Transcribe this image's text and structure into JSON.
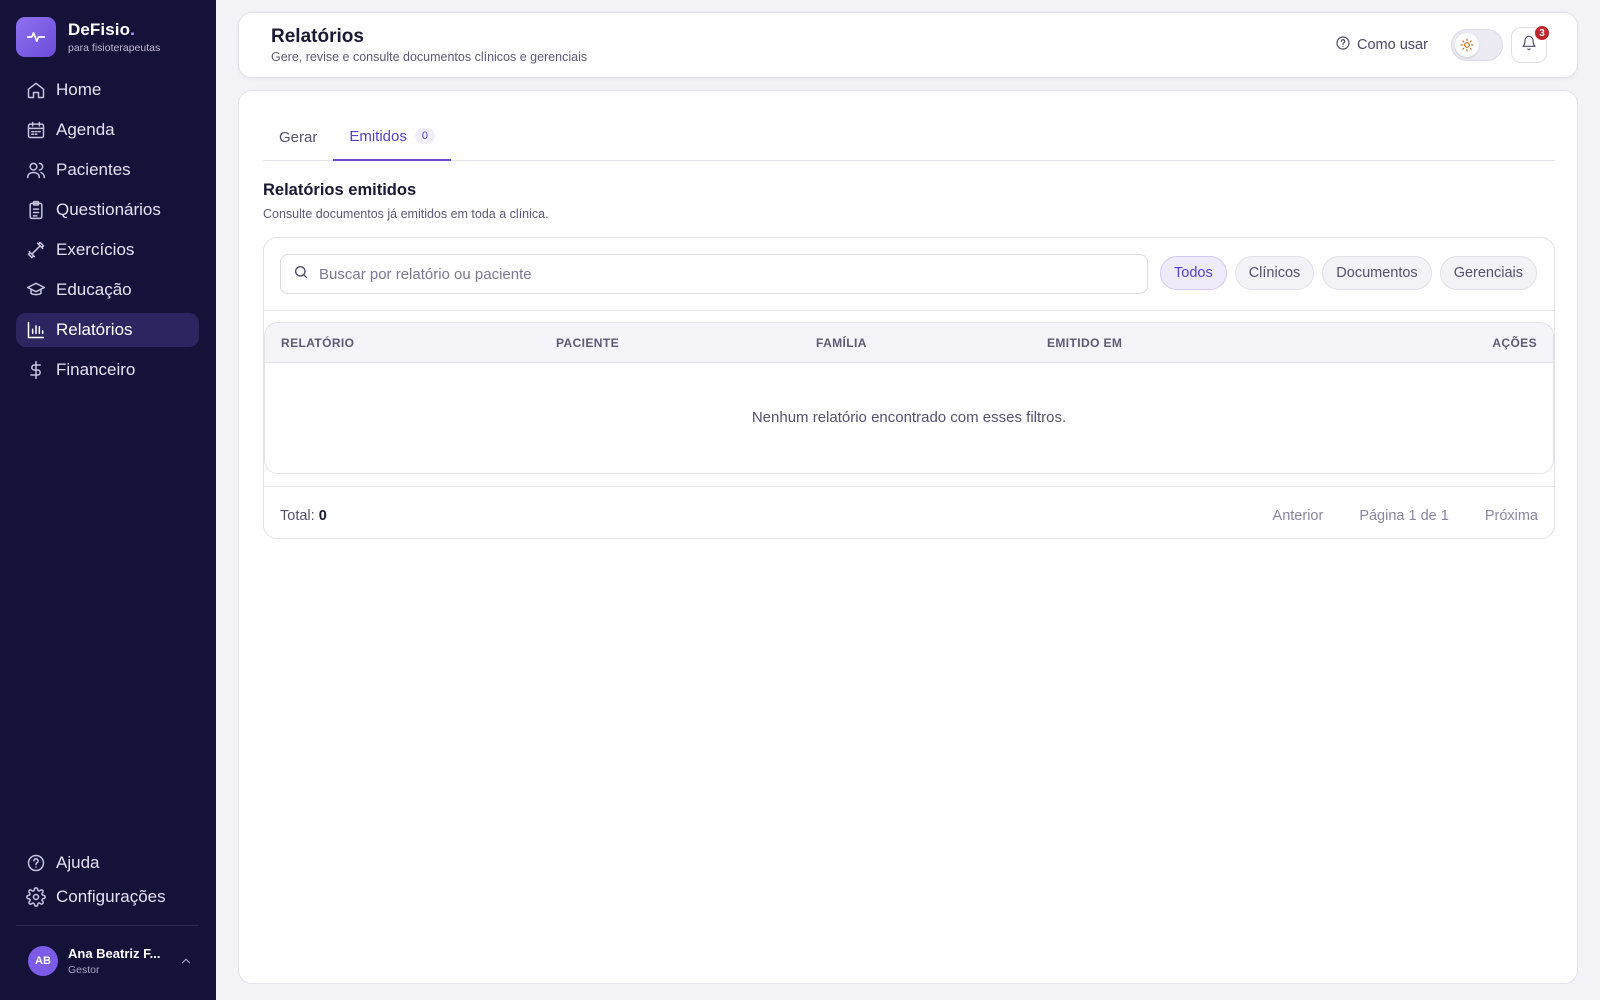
{
  "brand": {
    "name": "DeFisio",
    "dot": ".",
    "tagline": "para fisioterapeutas"
  },
  "sidebar": {
    "items": [
      {
        "label": "Home",
        "icon": "home-icon"
      },
      {
        "label": "Agenda",
        "icon": "calendar-icon"
      },
      {
        "label": "Pacientes",
        "icon": "users-icon"
      },
      {
        "label": "Questionários",
        "icon": "clipboard-icon"
      },
      {
        "label": "Exercícios",
        "icon": "dumbbell-icon"
      },
      {
        "label": "Educação",
        "icon": "graduation-cap-icon"
      },
      {
        "label": "Relatórios",
        "icon": "bar-chart-icon",
        "active": true
      },
      {
        "label": "Financeiro",
        "icon": "dollar-icon"
      }
    ],
    "bottom": [
      {
        "label": "Ajuda",
        "icon": "help-circle-icon"
      },
      {
        "label": "Configurações",
        "icon": "gear-icon"
      }
    ],
    "user": {
      "initials": "AB",
      "name": "Ana Beatriz F...",
      "role": "Gestor"
    }
  },
  "header": {
    "title": "Relatórios",
    "subtitle": "Gere, revise e consulte documentos clínicos e gerenciais",
    "how_to": "Como usar",
    "notifications": "3"
  },
  "tabs": [
    {
      "label": "Gerar"
    },
    {
      "label": "Emitidos",
      "count": "0",
      "active": true
    }
  ],
  "section": {
    "title": "Relatórios emitidos",
    "subtitle": "Consulte documentos já emitidos em toda a clínica."
  },
  "search": {
    "placeholder": "Buscar por relatório ou paciente",
    "value": ""
  },
  "filters": [
    "Todos",
    "Clínicos",
    "Documentos",
    "Gerenciais"
  ],
  "table": {
    "columns": [
      "RELATÓRIO",
      "PACIENTE",
      "FAMÍLIA",
      "EMITIDO EM",
      "AÇÕES"
    ],
    "empty": "Nenhum relatório encontrado com esses filtros."
  },
  "footer": {
    "total_label": "Total:",
    "total_value": "0",
    "prev": "Anterior",
    "page": "Página 1 de 1",
    "next": "Próxima"
  },
  "colors": {
    "sidebar_bg": "#15123a",
    "accent": "#6a4bd9",
    "badge": "#c02630"
  }
}
